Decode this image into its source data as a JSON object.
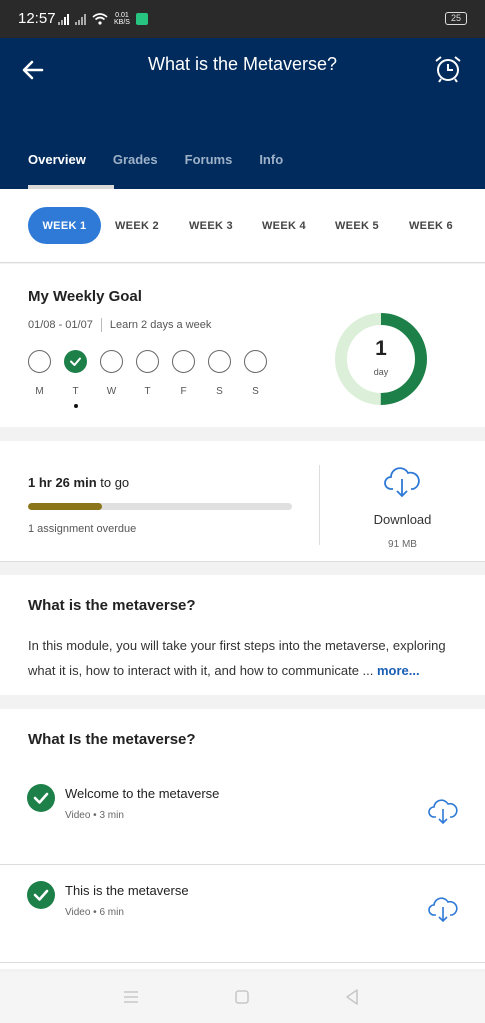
{
  "status": {
    "time": "12:57",
    "net_speed": "0.01",
    "net_unit": "KB/S",
    "battery": "25"
  },
  "appbar": {
    "title": "What is the Metaverse?",
    "tabs": [
      {
        "label": "Overview"
      },
      {
        "label": "Grades"
      },
      {
        "label": "Forums"
      },
      {
        "label": "Info"
      }
    ]
  },
  "weeks": [
    "WEEK 1",
    "WEEK 2",
    "WEEK 3",
    "WEEK 4",
    "WEEK 5",
    "WEEK 6"
  ],
  "goal": {
    "title": "My Weekly Goal",
    "date_range": "01/08 - 01/07",
    "target": "Learn 2 days a week",
    "days": [
      {
        "label": "M",
        "done": false
      },
      {
        "label": "T",
        "done": true
      },
      {
        "label": "W",
        "done": false
      },
      {
        "label": "T",
        "done": false
      },
      {
        "label": "F",
        "done": false
      },
      {
        "label": "S",
        "done": false
      },
      {
        "label": "S",
        "done": false
      }
    ],
    "progress_count": "1",
    "progress_unit": "day",
    "progress_fraction": 0.5
  },
  "progress": {
    "time_bold": "1 hr 26 min",
    "time_rest": " to go",
    "fraction": 0.28,
    "overdue": "1 assignment overdue",
    "download_label": "Download",
    "download_size": "91 MB"
  },
  "about": {
    "title": "What is the metaverse?",
    "text": "In this module, you will take your first steps into the metaverse, exploring what it is, how to interact with it, and how to communicate ... ",
    "more": "more..."
  },
  "section": {
    "title": "What Is the metaverse?",
    "lessons": [
      {
        "title": "Welcome to the metaverse",
        "meta": "Video • 3 min"
      },
      {
        "title": "This is the metaverse",
        "meta": "Video • 6 min"
      }
    ]
  },
  "colors": {
    "appbar": "#002b5c",
    "accent": "#2f7ad6",
    "success": "#1d8048",
    "progress": "#8b7519"
  }
}
